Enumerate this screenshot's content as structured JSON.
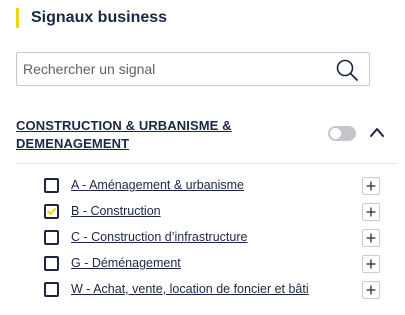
{
  "panel": {
    "title": "Signaux business",
    "accent_color": "#f3d21c"
  },
  "search": {
    "placeholder": "Rechercher un signal"
  },
  "category": {
    "title": "CONSTRUCTION & URBANISME & DEMENAGEMENT",
    "toggle_on": false,
    "expanded": true
  },
  "items": [
    {
      "label": "A - Aménagement & urbanisme",
      "checked": false
    },
    {
      "label": "B - Construction",
      "checked": true
    },
    {
      "label": "C - Construction d’infrastructure",
      "checked": false
    },
    {
      "label": "G - Déménagement",
      "checked": false
    },
    {
      "label": "W - Achat, vente, location de foncier et bâti",
      "checked": false
    }
  ],
  "icons": {
    "search": "search-icon",
    "collapse": "chevron-up-icon",
    "add": "plus-icon",
    "check": "check-icon"
  },
  "colors": {
    "text": "#1a2746",
    "check_mark": "#f3d21c",
    "toggle_off": "#c4c6cb"
  }
}
